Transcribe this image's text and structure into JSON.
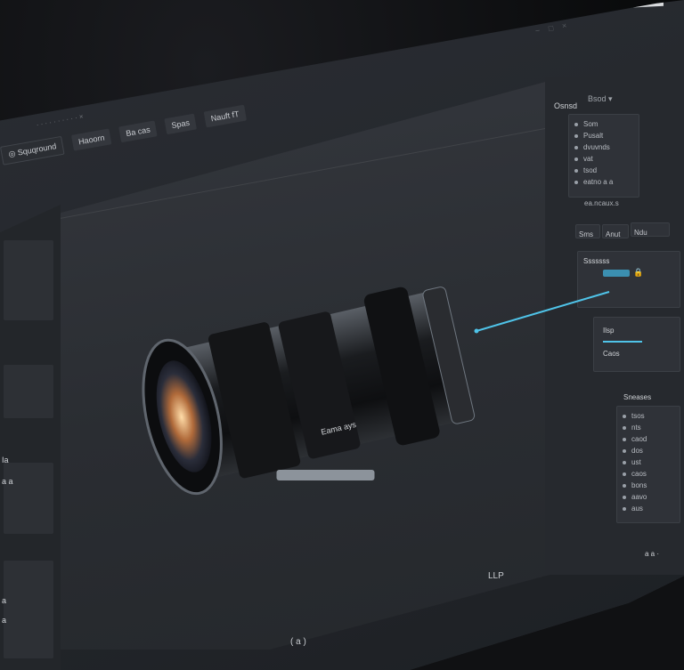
{
  "browser": {
    "tab_text": "· · · · · ·  ·  ·  ·  ·  ×",
    "window_controls": [
      "−",
      "□",
      "×"
    ]
  },
  "toolbar": {
    "brand": "Squqround",
    "buttons": [
      "Haoorn",
      "Ba cas",
      "Spas",
      "Nauft fT"
    ]
  },
  "left_panel": {
    "labels": [
      "Ia",
      "a a",
      "a",
      "a"
    ]
  },
  "right_panel": {
    "top_header": "Osnsd",
    "top_dropdown": "Bsod ▾",
    "top_list": [
      "Som",
      "Pusalt",
      "dvuvnds",
      "vat",
      "tsod",
      "eatno a a"
    ],
    "top_note": "ea.ncaux.s",
    "mid_tabs": [
      "Sms",
      "Anut",
      "Ndu"
    ],
    "mid_header": "Sssssss",
    "mid_list": [
      "Ilsp",
      "Caos"
    ],
    "bottom_header": "Sneases",
    "bottom_list": [
      "tsos",
      "nts",
      "caod",
      "dos",
      "ust",
      "caos",
      "bons",
      "aavo",
      "aus"
    ],
    "footer": "a a ·"
  },
  "lens": {
    "engraving": "Eama ays"
  },
  "viewport": {
    "center_label": "LLP",
    "bottom_label": "( a )"
  },
  "colors": {
    "accent": "#4fc3e8",
    "panel": "#26292e",
    "viewport": "#2e3136"
  }
}
